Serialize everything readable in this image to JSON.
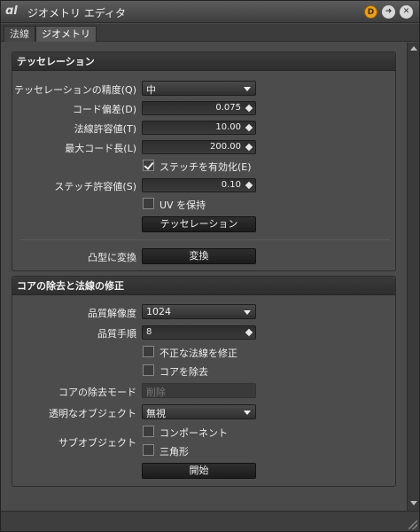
{
  "window": {
    "title": "ジオメトリ エディタ",
    "badge": "D"
  },
  "tabs": [
    {
      "label": "法線"
    },
    {
      "label": "ジオメトリ"
    }
  ],
  "tess": {
    "header": "テッセレーション",
    "precision_label": "テッセレーションの精度(Q)",
    "precision_value": "中",
    "chord_dev_label": "コード偏差(D)",
    "chord_dev_value": "0.075",
    "normal_tol_label": "法線許容値(T)",
    "normal_tol_value": "10.00",
    "max_chord_label": "最大コード長(L)",
    "max_chord_value": "200.00",
    "stitch_enable_label": "ステッチを有効化(E)",
    "stitch_enable_checked": true,
    "stitch_tol_label": "ステッチ許容値(S)",
    "stitch_tol_value": "0.10",
    "keep_uv_label": "UV を保持",
    "keep_uv_checked": false,
    "tess_button": "テッセレーション",
    "convex_label": "凸型に変換",
    "convert_button": "変換"
  },
  "core": {
    "header": "コアの除去と法線の修正",
    "quality_res_label": "品質解像度",
    "quality_res_value": "1024",
    "quality_steps_label": "品質手順",
    "quality_steps_value": "8",
    "fix_normals_label": "不正な法線を修正",
    "remove_core_label": "コアを除去",
    "core_mode_label": "コアの除去モード",
    "core_mode_value": "削除",
    "transparent_label": "透明なオブジェクト",
    "transparent_value": "無視",
    "subobject_label": "サブオブジェクト",
    "component_label": "コンポーネント",
    "triangle_label": "三角形",
    "start_button": "開始"
  }
}
